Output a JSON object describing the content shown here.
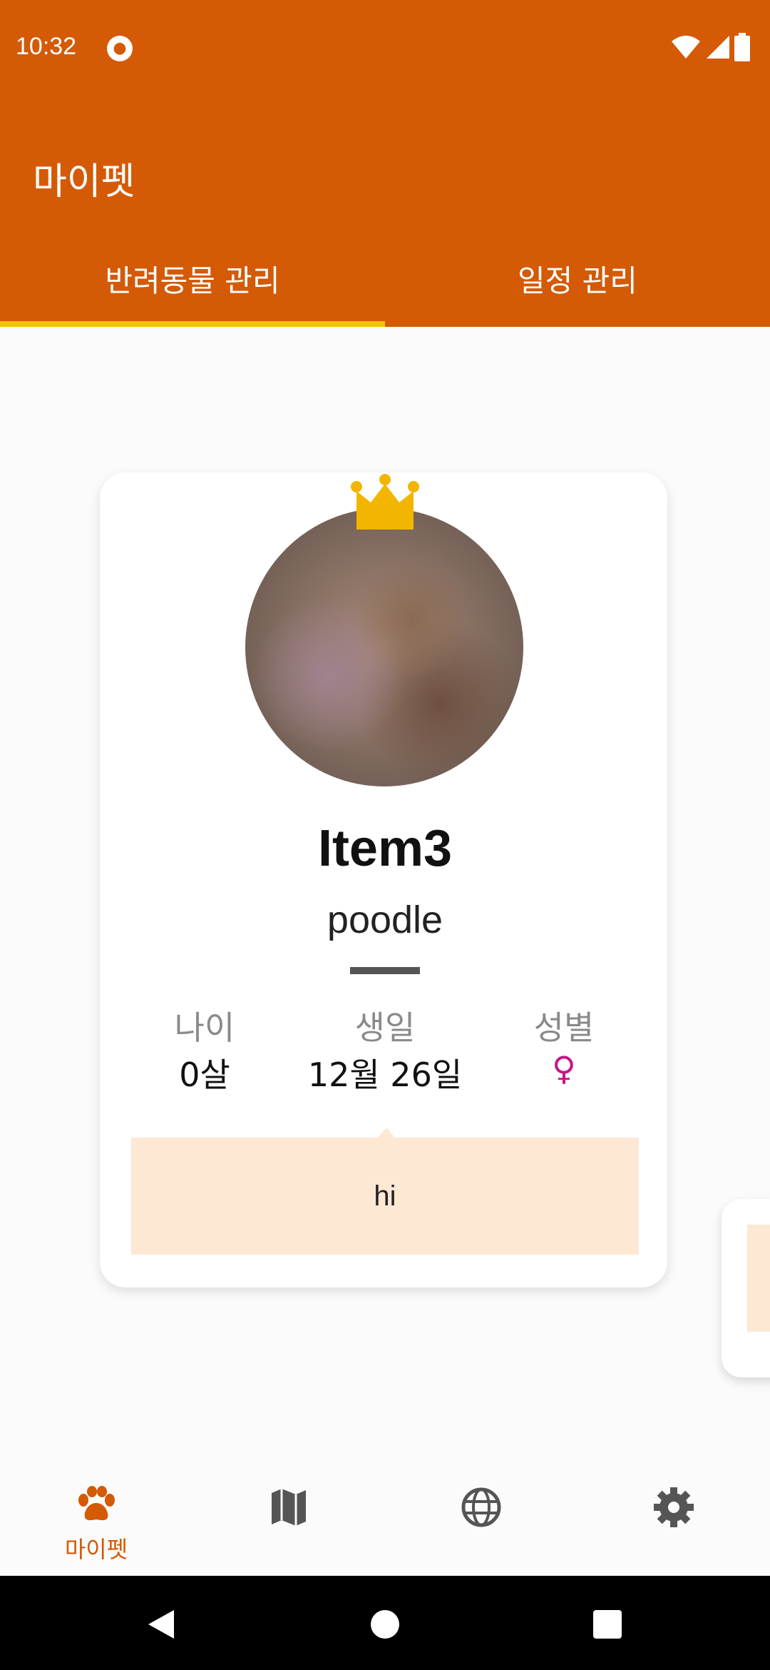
{
  "status_bar": {
    "time": "10:32",
    "notification_icon": "app-notification-icon"
  },
  "app": {
    "title": "마이펫"
  },
  "tabs": [
    {
      "label": "반려동물 관리",
      "selected": true
    },
    {
      "label": "일정 관리",
      "selected": false
    }
  ],
  "pet_card": {
    "name": "Item3",
    "breed": "poodle",
    "stats": [
      {
        "label": "나이",
        "value": "0살"
      },
      {
        "label": "생일",
        "value": "12월 26일"
      },
      {
        "label": "성별",
        "value": "♀"
      }
    ],
    "memo": "hi",
    "crown_icon": "crown-icon"
  },
  "bottom_nav": [
    {
      "icon": "paw-icon",
      "label": "마이펫",
      "selected": true
    },
    {
      "icon": "map-icon",
      "label": "",
      "selected": false
    },
    {
      "icon": "globe-icon",
      "label": "",
      "selected": false
    },
    {
      "icon": "gear-icon",
      "label": "",
      "selected": false
    }
  ],
  "colors": {
    "primary": "#d45a06",
    "tab_indicator": "#f2c400",
    "memo_bg": "#fde8d4",
    "gender_female": "#c2168a"
  }
}
